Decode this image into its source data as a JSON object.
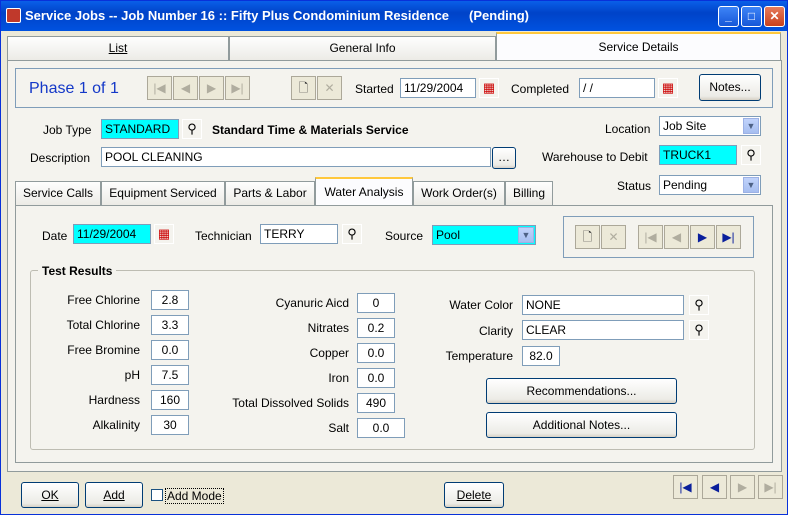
{
  "window": {
    "title": "Service Jobs -- Job Number 16 :: Fifty Plus Condominium Residence",
    "status": "(Pending)"
  },
  "top_tabs": [
    "List",
    "General Info",
    "Service Details"
  ],
  "phase": {
    "label": "Phase 1 of  1",
    "started_label": "Started",
    "started_value": "11/29/2004",
    "completed_label": "Completed",
    "completed_value": " / /",
    "notes_label": "Notes..."
  },
  "job": {
    "job_type_label": "Job Type",
    "job_type_value": "STANDARD",
    "job_type_desc": "Standard Time & Materials Service",
    "description_label": "Description",
    "description_value": "POOL CLEANING",
    "location_label": "Location",
    "location_value": "Job Site",
    "warehouse_label": "Warehouse to Debit",
    "warehouse_value": "TRUCK1",
    "status_label": "Status",
    "status_value": "Pending"
  },
  "sub_tabs": [
    "Service Calls",
    "Equipment Serviced",
    "Parts & Labor",
    "Water Analysis",
    "Work Order(s)",
    "Billing"
  ],
  "water": {
    "date_label": "Date",
    "date_value": "11/29/2004",
    "tech_label": "Technician",
    "tech_value": "TERRY",
    "source_label": "Source",
    "source_value": "Pool",
    "group_title": "Test Results",
    "col1": [
      {
        "label": "Free Chlorine",
        "value": "2.8"
      },
      {
        "label": "Total Chlorine",
        "value": "3.3"
      },
      {
        "label": "Free Bromine",
        "value": "0.0"
      },
      {
        "label": "pH",
        "value": "7.5"
      },
      {
        "label": "Hardness",
        "value": "160"
      },
      {
        "label": "Alkalinity",
        "value": "30"
      }
    ],
    "col2": [
      {
        "label": "Cyanuric Aicd",
        "value": "0"
      },
      {
        "label": "Nitrates",
        "value": "0.2"
      },
      {
        "label": "Copper",
        "value": "0.0"
      },
      {
        "label": "Iron",
        "value": "0.0"
      },
      {
        "label": "Total Dissolved Solids",
        "value": "490"
      },
      {
        "label": "Salt",
        "value": "0.0"
      }
    ],
    "color_label": "Water Color",
    "color_value": "NONE",
    "clarity_label": "Clarity",
    "clarity_value": "CLEAR",
    "temp_label": "Temperature",
    "temp_value": "82.0",
    "recommend_label": "Recommendations...",
    "notes_label": "Additional Notes..."
  },
  "footer": {
    "ok": "OK",
    "add": "Add",
    "add_mode": "Add Mode",
    "delete": "Delete"
  }
}
